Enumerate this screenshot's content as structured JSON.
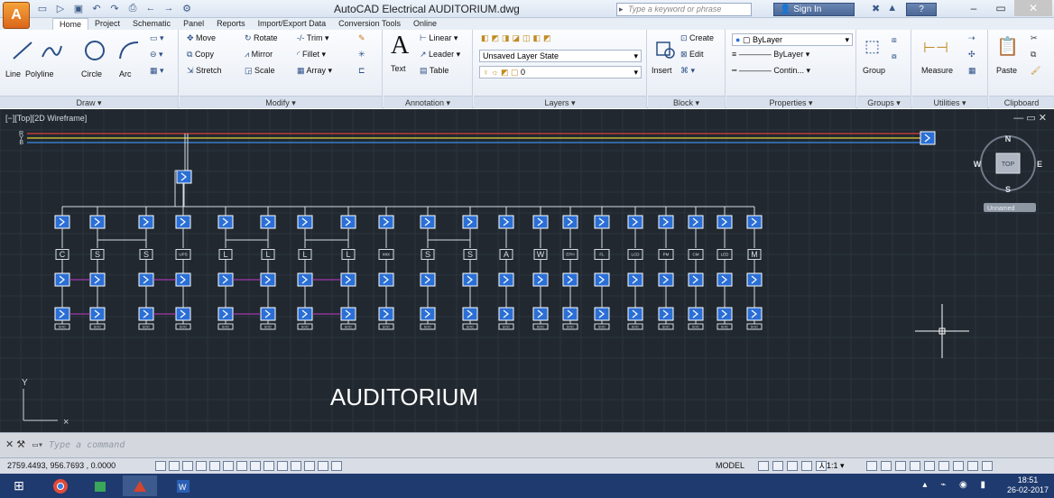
{
  "app": {
    "title": "AutoCAD Electrical    AUDITORIUM.dwg",
    "search_placeholder": "Type a keyword or phrase",
    "sign_in": "Sign In",
    "app_letter": "A"
  },
  "ribbon_tabs": [
    "Home",
    "Project",
    "Schematic",
    "Panel",
    "Reports",
    "Import/Export Data",
    "Conversion Tools",
    "Online"
  ],
  "active_tab": "Home",
  "panels": {
    "draw": {
      "label": "Draw ▾",
      "tools": [
        "Line",
        "Polyline",
        "Circle",
        "Arc"
      ]
    },
    "modify": {
      "label": "Modify ▾",
      "rows": [
        [
          "Move",
          "Rotate",
          "Trim ▾"
        ],
        [
          "Copy",
          "Mirror",
          "Fillet ▾"
        ],
        [
          "Stretch",
          "Scale",
          "Array ▾"
        ]
      ]
    },
    "annotation": {
      "label": "Annotation ▾",
      "big": "Text",
      "rows": [
        "Linear ▾",
        "Leader ▾",
        "Table"
      ]
    },
    "layers": {
      "label": "Layers ▾",
      "state": "Unsaved Layer State",
      "current": "0"
    },
    "block": {
      "label": "Block ▾",
      "big": "Insert",
      "rows": [
        "Create",
        "Edit"
      ]
    },
    "properties": {
      "label": "Properties ▾",
      "color": "ByLayer",
      "lineweight": "ByLayer",
      "linetype": "Contin..."
    },
    "groups": {
      "label": "Groups ▾",
      "big": "Group"
    },
    "utilities": {
      "label": "Utilities ▾",
      "big": "Measure"
    },
    "clipboard": {
      "label": "Clipboard",
      "big": "Paste"
    }
  },
  "viewport": {
    "label": "[−][Top][2D Wireframe]",
    "phase_labels": [
      "R",
      "Y",
      "B"
    ],
    "drawing_title": "AUDITORIUM",
    "viewcube": {
      "north": "N",
      "south": "S",
      "east": "E",
      "west": "W",
      "top": "TOP",
      "ucs": "Unnamed"
    },
    "load_labels": [
      "C",
      "S",
      "S",
      "UPS",
      "L",
      "L",
      "L",
      "L",
      "MIX",
      "S",
      "S",
      "A",
      "W",
      "EPH",
      "FL",
      "LCD",
      "PM",
      "CM",
      "LED",
      "M"
    ],
    "bottom_tag": "SOC"
  },
  "command": {
    "placeholder": "Type a command"
  },
  "status": {
    "coords": "2759.4493, 956.7693 , 0.0000",
    "model": "MODEL",
    "scale": "1:1 ▾"
  },
  "clock": {
    "time": "18:51",
    "date": "26-02-2017"
  },
  "colors": {
    "accent": "#2b6fd6",
    "canvas": "#212830",
    "phase_r": "#d9403a",
    "phase_y": "#e8d13a",
    "phase_b": "#3a8ee8",
    "link": "#c13bc9"
  }
}
